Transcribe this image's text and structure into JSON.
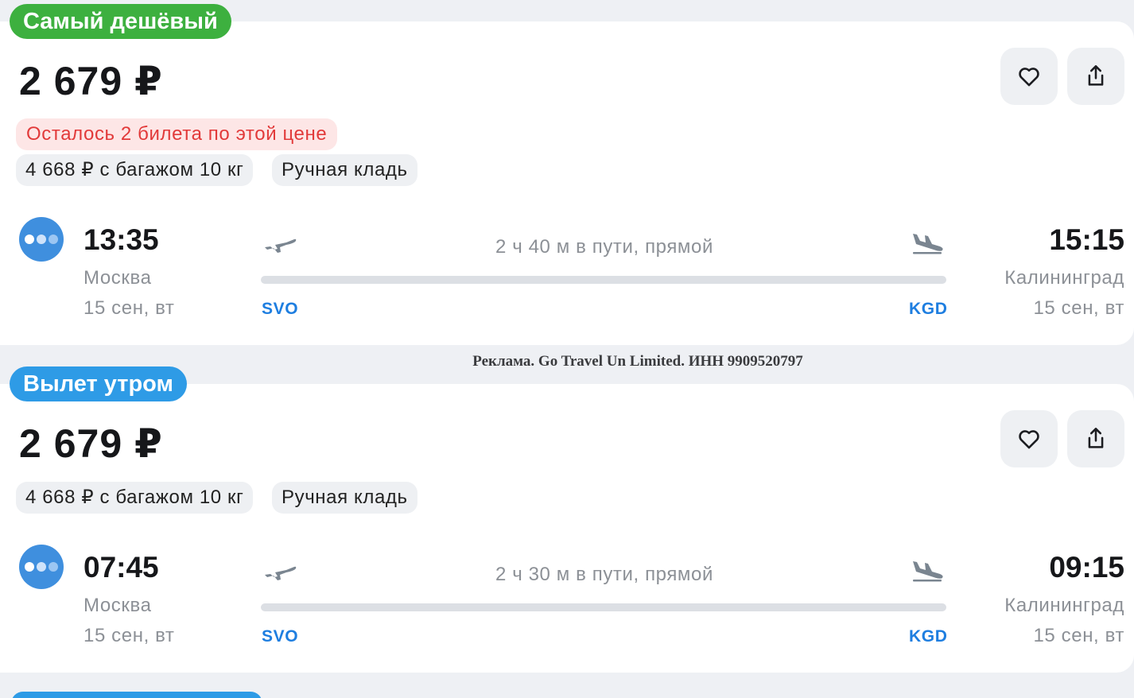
{
  "offers": [
    {
      "tag": "Самый дешёвый",
      "tag_color": "#3db03f",
      "price": "2 679 ₽",
      "warning": "Осталось 2 билета по этой цене",
      "baggage_option": "4 668 ₽ с багажом 10 кг",
      "hand_luggage": "Ручная кладь",
      "depart_time": "13:35",
      "depart_city": "Москва",
      "depart_date": "15 сен, вт",
      "depart_iata": "SVO",
      "arrive_time": "15:15",
      "arrive_city": "Калининград",
      "arrive_date": "15 сен, вт",
      "arrive_iata": "KGD",
      "duration": "2 ч 40 м в пути, прямой"
    },
    {
      "tag": "Вылет утром",
      "tag_color": "#2e9be6",
      "price": "2 679 ₽",
      "baggage_option": "4 668 ₽ с багажом 10 кг",
      "hand_luggage": "Ручная кладь",
      "depart_time": "07:45",
      "depart_city": "Москва",
      "depart_date": "15 сен, вт",
      "depart_iata": "SVO",
      "arrive_time": "09:15",
      "arrive_city": "Калининград",
      "arrive_date": "15 сен, вт",
      "arrive_iata": "KGD",
      "duration": "2 ч 30 м в пути, прямой"
    }
  ],
  "ad_notice": "Реклама. Go Travel Un Limited. ИНН 9909520797",
  "icons": {
    "favorite": "heart-icon",
    "share": "share-icon",
    "airline": "airline-logo",
    "takeoff": "plane-takeoff-icon",
    "landing": "plane-landing-icon"
  }
}
